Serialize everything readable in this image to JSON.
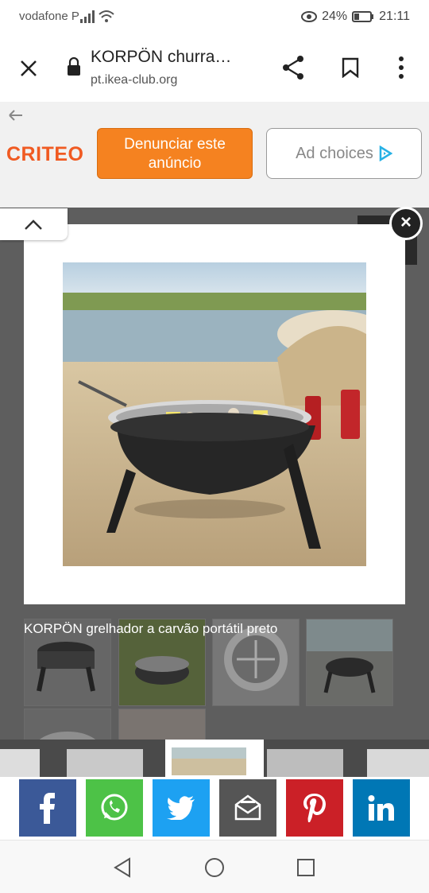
{
  "status_bar": {
    "carrier": "vodafone P",
    "battery": "24%",
    "time": "21:11"
  },
  "browser": {
    "title": "KORPÖN churra…",
    "url": "pt.ikea-club.org"
  },
  "ad_bar": {
    "brand": "CRITEO",
    "report_label": "Denunciar este anúncio",
    "adchoices_label": "Ad choices"
  },
  "lightbox": {
    "caption": "KORPÖN grelhador a carvão portátil preto",
    "close_glyph": "×"
  },
  "share": [
    {
      "name": "facebook",
      "color": "#3b5998"
    },
    {
      "name": "whatsapp",
      "color": "#4dc247"
    },
    {
      "name": "twitter",
      "color": "#1da1f2"
    },
    {
      "name": "email",
      "color": "#555555"
    },
    {
      "name": "pinterest",
      "color": "#cb2027"
    },
    {
      "name": "linkedin",
      "color": "#0077b5"
    }
  ]
}
